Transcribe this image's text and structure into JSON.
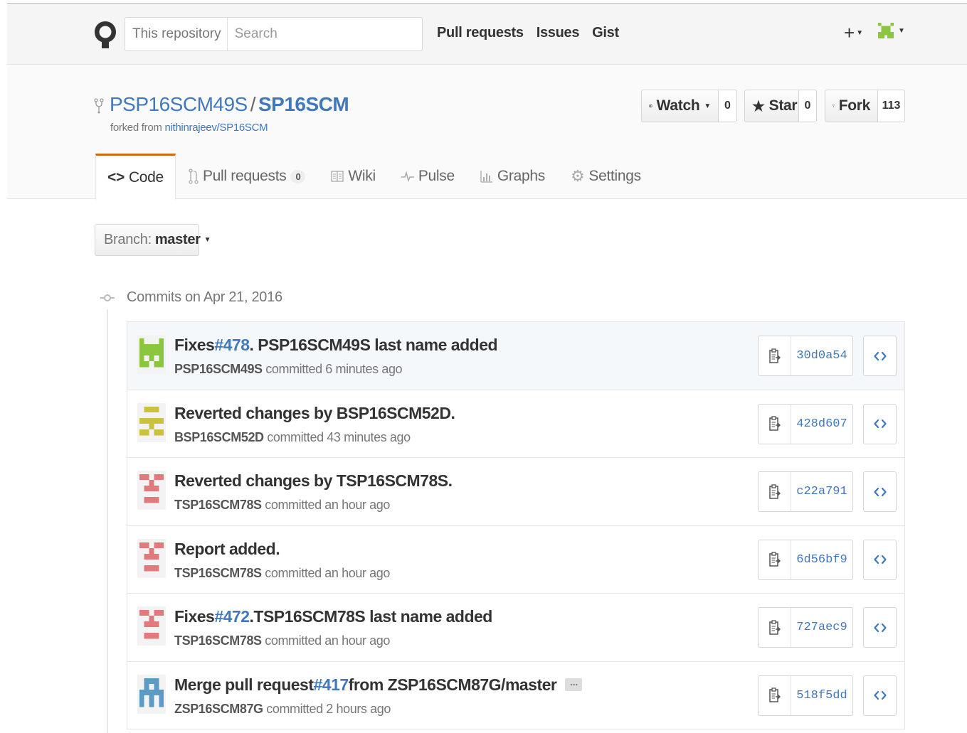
{
  "header": {
    "search_scope": "This repository",
    "search_placeholder": "Search",
    "nav": [
      "Pull requests",
      "Issues",
      "Gist"
    ],
    "plus_label": "+"
  },
  "repo": {
    "owner": "PSP16SCM49S",
    "separator": "/",
    "name": "SP16SCM",
    "forked_from_prefix": "forked from ",
    "forked_from": "nithinrajeev/SP16SCM",
    "watch": {
      "label": "Watch",
      "count": "0"
    },
    "star": {
      "label": "Star",
      "count": "0"
    },
    "fork": {
      "label": "Fork",
      "count": "113"
    }
  },
  "tabs": [
    {
      "label": "Code",
      "icon": "code-icon"
    },
    {
      "label": "Pull requests",
      "counter": "0",
      "icon": "pull-request-icon"
    },
    {
      "label": "Wiki",
      "icon": "book-icon"
    },
    {
      "label": "Pulse",
      "icon": "pulse-icon"
    },
    {
      "label": "Graphs",
      "icon": "graph-icon"
    },
    {
      "label": "Settings",
      "icon": "gear-icon"
    }
  ],
  "branch": {
    "label": "Branch:",
    "value": "master"
  },
  "commit_group": {
    "title": "Commits on Apr 21, 2016"
  },
  "commits": [
    {
      "msg_pre": "Fixes ",
      "issue": "#478",
      "msg_post": ". PSP16SCM49S last name added",
      "author": "PSP16SCM49S",
      "action": " committed ",
      "time": "6 minutes ago",
      "sha": "30d0a54",
      "avatar_color": "#8cc63f"
    },
    {
      "msg_pre": "Reverted changes by BSP16SCM52D.",
      "issue": "",
      "msg_post": "",
      "author": "BSP16SCM52D",
      "action": " committed ",
      "time": "43 minutes ago",
      "sha": "428d607",
      "avatar_color": "#c9c23a"
    },
    {
      "msg_pre": "Reverted changes by TSP16SCM78S.",
      "issue": "",
      "msg_post": "",
      "author": "TSP16SCM78S",
      "action": " committed ",
      "time": "an hour ago",
      "sha": "c22a791",
      "avatar_color": "#e2797d"
    },
    {
      "msg_pre": "Report added.",
      "issue": "",
      "msg_post": "",
      "author": "TSP16SCM78S",
      "action": " committed ",
      "time": "an hour ago",
      "sha": "6d56bf9",
      "avatar_color": "#e2797d"
    },
    {
      "msg_pre": "Fixes ",
      "issue": "#472",
      "msg_post": ".TSP16SCM78S last name added",
      "author": "TSP16SCM78S",
      "action": " committed ",
      "time": "an hour ago",
      "sha": "727aec9",
      "avatar_color": "#e2797d"
    },
    {
      "msg_pre": "Merge pull request ",
      "issue": "#417",
      "msg_post": " from ZSP16SCM87G/master",
      "author": "ZSP16SCM87G",
      "action": " committed ",
      "time": "2 hours ago",
      "sha": "518f5dd",
      "avatar_color": "#5b9bc6",
      "ellipsis": "…"
    }
  ]
}
